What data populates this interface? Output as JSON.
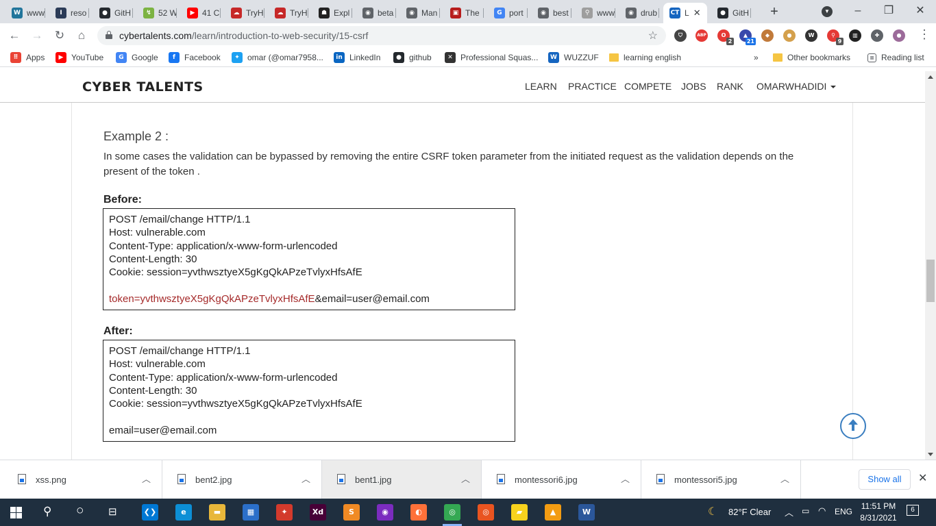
{
  "browser": {
    "tabs": [
      {
        "title": "www",
        "icon": "wordpress-icon",
        "color": "#21759b",
        "glyph": "W"
      },
      {
        "title": "reso",
        "icon": "i-icon",
        "color": "#2b3b57",
        "glyph": "I"
      },
      {
        "title": "GitH",
        "icon": "github-icon",
        "color": "#24292e",
        "glyph": "●"
      },
      {
        "title": "52 W",
        "icon": "leaf-icon",
        "color": "#7cb342",
        "glyph": "↯"
      },
      {
        "title": "41 C",
        "icon": "youtube-icon",
        "color": "#ff0000",
        "glyph": "▶"
      },
      {
        "title": "TryH",
        "icon": "cloud-icon",
        "color": "#c62828",
        "glyph": "☁"
      },
      {
        "title": "TryH",
        "icon": "cloud-icon",
        "color": "#c62828",
        "glyph": "☁"
      },
      {
        "title": "Expl",
        "icon": "ghost-icon",
        "color": "#222",
        "glyph": "☗"
      },
      {
        "title": "beta",
        "icon": "globe-icon",
        "color": "#5f6368",
        "glyph": "◉"
      },
      {
        "title": "Man",
        "icon": "globe-icon",
        "color": "#5f6368",
        "glyph": "◉"
      },
      {
        "title": "The",
        "icon": "projector-icon",
        "color": "#b71c1c",
        "glyph": "▣"
      },
      {
        "title": "port",
        "icon": "google-icon",
        "color": "#4285f4",
        "glyph": "G"
      },
      {
        "title": "best",
        "icon": "globe-icon",
        "color": "#5f6368",
        "glyph": "◉"
      },
      {
        "title": "www",
        "icon": "signal-icon",
        "color": "#9e9e9e",
        "glyph": "⚲"
      },
      {
        "title": "drub",
        "icon": "globe-icon",
        "color": "#5f6368",
        "glyph": "◉"
      },
      {
        "title": "L",
        "icon": "cybertalents-icon",
        "color": "#1565c0",
        "glyph": "CT",
        "active": true
      },
      {
        "title": "GitH",
        "icon": "github-icon",
        "color": "#24292e",
        "glyph": "●"
      }
    ],
    "url_domain": "cybertalents.com",
    "url_path": "/learn/introduction-to-web-security/15-csrf",
    "extensions": [
      {
        "name": "shield-extension-icon",
        "color": "#444",
        "glyph": "⛉",
        "badge": ""
      },
      {
        "name": "adblock-plus-icon",
        "color": "#e53935",
        "glyph": "ABP",
        "badge": ""
      },
      {
        "name": "opera-extension-icon",
        "color": "#e53935",
        "glyph": "O",
        "badge": "2"
      },
      {
        "name": "graduation-cap-extension-icon",
        "color": "#3949ab",
        "glyph": "▲",
        "badge": "21"
      },
      {
        "name": "cookie-editor-icon",
        "color": "#c17a3a",
        "glyph": "◆",
        "badge": ""
      },
      {
        "name": "cookie-icon",
        "color": "#d4a04c",
        "glyph": "●",
        "badge": ""
      },
      {
        "name": "wappalyzer-icon",
        "color": "#333",
        "glyph": "W",
        "badge": ""
      },
      {
        "name": "hacktools-icon",
        "color": "#e53935",
        "glyph": "⚲",
        "badge": "9"
      },
      {
        "name": "library-icon",
        "color": "#222",
        "glyph": "▥",
        "badge": ""
      },
      {
        "name": "puzzle-extensions-icon",
        "color": "#5f6368",
        "glyph": "✚",
        "badge": ""
      },
      {
        "name": "profile-avatar-icon",
        "color": "#9c6b9a",
        "glyph": "●",
        "badge": ""
      }
    ],
    "bookmarks": [
      {
        "label": "Apps",
        "icon": "apps-grid-icon",
        "color": "#ea4335",
        "glyph": "⠿"
      },
      {
        "label": "YouTube",
        "icon": "youtube-icon",
        "color": "#ff0000",
        "glyph": "▶"
      },
      {
        "label": "Google",
        "icon": "google-icon",
        "color": "#4285f4",
        "glyph": "G"
      },
      {
        "label": "Facebook",
        "icon": "facebook-icon",
        "color": "#1877f2",
        "glyph": "f"
      },
      {
        "label": "omar (@omar7958...",
        "icon": "twitter-icon",
        "color": "#1da1f2",
        "glyph": "✦"
      },
      {
        "label": "LinkedIn",
        "icon": "linkedin-icon",
        "color": "#0a66c2",
        "glyph": "in"
      },
      {
        "label": "github",
        "icon": "github-icon",
        "color": "#24292e",
        "glyph": "●"
      },
      {
        "label": "Professional Squas...",
        "icon": "squash-icon",
        "color": "#333",
        "glyph": "✕"
      },
      {
        "label": "WUZZUF",
        "icon": "wuzzuf-icon",
        "color": "#1565c0",
        "glyph": "W"
      },
      {
        "label": "learning english",
        "icon": "folder-icon",
        "color": "#f5c543",
        "glyph": ""
      }
    ],
    "bookmarks_overflow": "»",
    "other_bookmarks": "Other bookmarks",
    "reading_list": "Reading list"
  },
  "site": {
    "logo": "CYBER TALENTS",
    "nav": [
      "LEARN",
      "PRACTICE",
      "COMPETE",
      "JOBS",
      "RANK"
    ],
    "user": "OMARWHADIDI"
  },
  "content": {
    "example_title": "Example 2 :",
    "description": "In some cases the validation can be bypassed by removing the entire CSRF token parameter from the initiated request as the validation depends on the present of the token .",
    "before_label": "Before:",
    "before_lines": [
      "POST /email/change HTTP/1.1",
      "Host: vulnerable.com",
      "Content-Type: application/x-www-form-urlencoded",
      "Content-Length: 30",
      "Cookie: session=yvthwsztyeX5gKgQkAPzeTvlyxHfsAfE"
    ],
    "before_token": "token=yvthwsztyeX5gKgQkAPzeTvlyxHfsAfE",
    "before_body_rest": "&email=user@email.com",
    "after_label": "After:",
    "after_lines": [
      "POST /email/change HTTP/1.1",
      "Host: vulnerable.com",
      "Content-Type: application/x-www-form-urlencoded",
      "Content-Length: 30",
      "Cookie: session=yvthwsztyeX5gKgQkAPzeTvlyxHfsAfE"
    ],
    "after_body": "email=user@email.com"
  },
  "downloads": {
    "files": [
      "xss.png",
      "bent2.jpg",
      "bent1.jpg",
      "montessori6.jpg",
      "montessori5.jpg"
    ],
    "show_all": "Show all"
  },
  "taskbar": {
    "weather": "82°F  Clear",
    "language": "ENG",
    "time": "11:51 PM",
    "date": "8/31/2021",
    "notifications": "6",
    "apps": [
      {
        "name": "vscode-icon",
        "color": "#0078d4",
        "glyph": "❮❯"
      },
      {
        "name": "edge-icon",
        "color": "#0c8fd6",
        "glyph": "e"
      },
      {
        "name": "file-explorer-icon",
        "color": "#e8b73a",
        "glyph": "▬"
      },
      {
        "name": "store-icon",
        "color": "#2b6fc9",
        "glyph": "▦"
      },
      {
        "name": "git-gui-icon",
        "color": "#d33a2c",
        "glyph": "✦"
      },
      {
        "name": "adobe-xd-icon",
        "color": "#470137",
        "glyph": "Xd"
      },
      {
        "name": "sublime-text-icon",
        "color": "#f08a24",
        "glyph": "S"
      },
      {
        "name": "podcast-icon",
        "color": "#7b2cbf",
        "glyph": "◉"
      },
      {
        "name": "firefox-icon",
        "color": "#ff7139",
        "glyph": "◐"
      },
      {
        "name": "chrome-icon",
        "color": "#34a853",
        "glyph": "◎"
      },
      {
        "name": "ubuntu-icon",
        "color": "#e95420",
        "glyph": "◎"
      },
      {
        "name": "sticky-notes-icon",
        "color": "#f7d21d",
        "glyph": "▰"
      },
      {
        "name": "vlc-icon",
        "color": "#f39c12",
        "glyph": "▲"
      },
      {
        "name": "word-icon",
        "color": "#2b579a",
        "glyph": "W"
      }
    ]
  }
}
